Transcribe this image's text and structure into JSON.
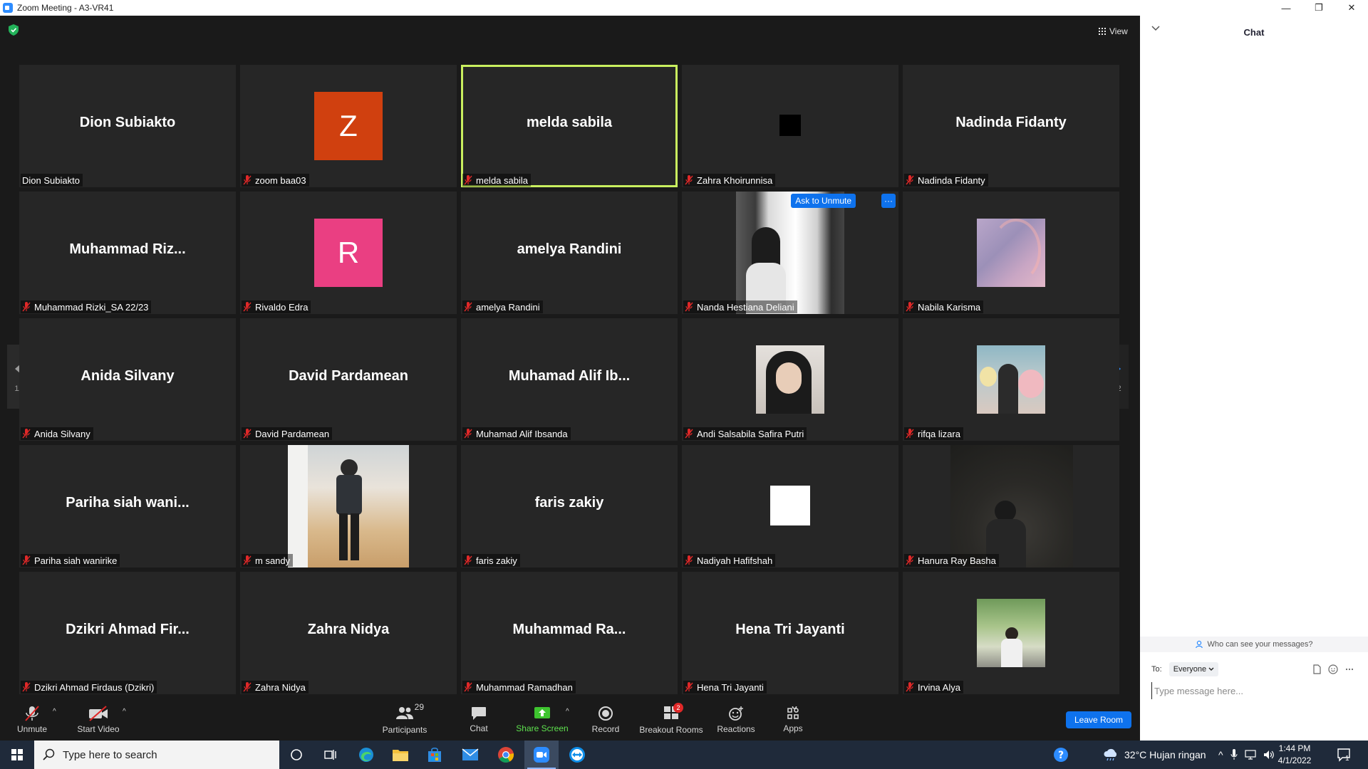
{
  "window": {
    "title": "Zoom Meeting - A3-VR41",
    "minimize": "—",
    "restore": "❐",
    "close": "✕"
  },
  "header": {
    "view_label": "View"
  },
  "pagination": {
    "left_page": "1/2",
    "right_page": "1/2"
  },
  "tiles": [
    {
      "big_name": "Dion Subiakto",
      "caption": "Dion Subiakto"
    },
    {
      "avatar_letter": "Z",
      "avatar_color": "#d0400f",
      "caption": "zoom baa03"
    },
    {
      "big_name": "melda sabila",
      "caption": "melda sabila"
    },
    {
      "caption": "Zahra Khoirunnisa"
    },
    {
      "big_name": "Nadinda Fidanty",
      "caption": "Nadinda Fidanty"
    },
    {
      "big_name": "Muhammad  Riz...",
      "caption": "Muhammad Rizki_SA 22/23"
    },
    {
      "avatar_letter": "R",
      "avatar_color": "#ea3f82",
      "caption": "Rivaldo Edra"
    },
    {
      "big_name": "amelya Randini",
      "caption": "amelya Randini"
    },
    {
      "caption": "Nanda Hestiana Deliani",
      "ask_unmute": "Ask to Unmute",
      "more": "···"
    },
    {
      "caption": "Nabila Karisma"
    },
    {
      "big_name": "Anida Silvany",
      "caption": "Anida Silvany"
    },
    {
      "big_name": "David Pardamean",
      "caption": "David Pardamean"
    },
    {
      "big_name": "Muhamad  Alif  Ib...",
      "caption": "Muhamad Alif Ibsanda"
    },
    {
      "caption": "Andi Salsabila Safira Putri"
    },
    {
      "caption": "rifqa lizara"
    },
    {
      "big_name": "Pariha  siah  wani...",
      "caption": "Pariha siah wanirike"
    },
    {
      "caption": "m sandy"
    },
    {
      "big_name": "faris zakiy",
      "caption": "faris zakiy"
    },
    {
      "caption": "Nadiyah Hafifshah"
    },
    {
      "caption": "Hanura Ray Basha"
    },
    {
      "big_name": "Dzikri  Ahmad  Fir...",
      "caption": "Dzikri Ahmad Firdaus (Dzikri)"
    },
    {
      "big_name": "Zahra Nidya",
      "caption": "Zahra Nidya"
    },
    {
      "big_name": "Muhammad  Ra...",
      "caption": "Muhammad Ramadhan"
    },
    {
      "big_name": "Hena Tri Jayanti",
      "caption": "Hena Tri Jayanti"
    },
    {
      "caption": "Irvina Alya"
    }
  ],
  "toolbar": {
    "unmute": "Unmute",
    "start_video": "Start Video",
    "participants": "Participants",
    "participants_count": "29",
    "chat": "Chat",
    "share_screen": "Share Screen",
    "record": "Record",
    "breakout_rooms": "Breakout Rooms",
    "breakout_badge": "2",
    "reactions": "Reactions",
    "apps": "Apps",
    "leave_room": "Leave Room"
  },
  "chat": {
    "title": "Chat",
    "who_can_see": "Who can see your messages?",
    "to_label": "To:",
    "to_value": "Everyone",
    "placeholder": "Type message here..."
  },
  "taskbar": {
    "search_placeholder": "Type here to search",
    "weather": "32°C  Hujan ringan",
    "time": "1:44 PM",
    "date": "4/1/2022",
    "notifications": "1"
  },
  "colors": {
    "accent": "#0e72ed",
    "active_speaker": "#c9ef5f",
    "muted": "#e02828",
    "share_green": "#5ee14e"
  }
}
